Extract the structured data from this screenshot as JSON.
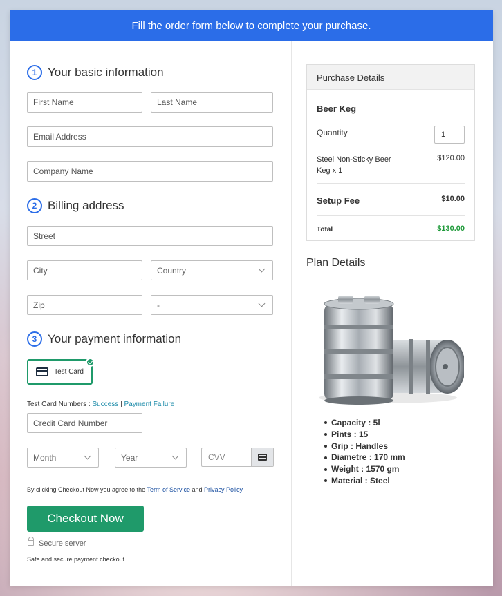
{
  "banner": "Fill the order form below to complete your purchase.",
  "sections": {
    "basic": {
      "number": "1",
      "title": "Your basic information"
    },
    "billing": {
      "number": "2",
      "title": "Billing address"
    },
    "payment": {
      "number": "3",
      "title": "Your payment information"
    }
  },
  "fields": {
    "first_name": "First Name",
    "last_name": "Last Name",
    "email": "Email Address",
    "company": "Company Name",
    "street": "Street",
    "city": "City",
    "country": "Country",
    "zip": "Zip",
    "state": "-",
    "card_number": "Credit Card Number",
    "month": "Month",
    "year": "Year",
    "cvv": "CVV"
  },
  "payment": {
    "test_card_label": "Test Card",
    "test_numbers_prefix": "Test Card Numbers :",
    "success_link": "Success",
    "separator": "|",
    "failure_link": "Payment Failure"
  },
  "terms": {
    "prefix": "By clicking Checkout Now you agree to the",
    "tos_link": "Term of Service",
    "and": "and",
    "privacy_link": "Privacy Policy"
  },
  "checkout_button": "Checkout Now",
  "secure_server": "Secure server",
  "secure_note": "Safe and secure payment checkout.",
  "purchase": {
    "header": "Purchase Details",
    "product": "Beer Keg",
    "quantity_label": "Quantity",
    "quantity_value": "1",
    "item_line1": "Steel Non-Sticky Beer",
    "item_line2": "Keg x 1",
    "item_price": "$120.00",
    "setup_label": "Setup Fee",
    "setup_price": "$10.00",
    "total_label": "Total",
    "total_price": "$130.00"
  },
  "plan": {
    "title": "Plan Details",
    "specs": [
      "Capacity : 5l",
      "Pints : 15",
      "Grip : Handles",
      "Diametre : 170 mm",
      "Weight : 1570 gm",
      "Material : Steel"
    ]
  },
  "colors": {
    "banner": "#2b6de8",
    "accent_green": "#1f9a6a",
    "link": "#1a8aa8"
  }
}
